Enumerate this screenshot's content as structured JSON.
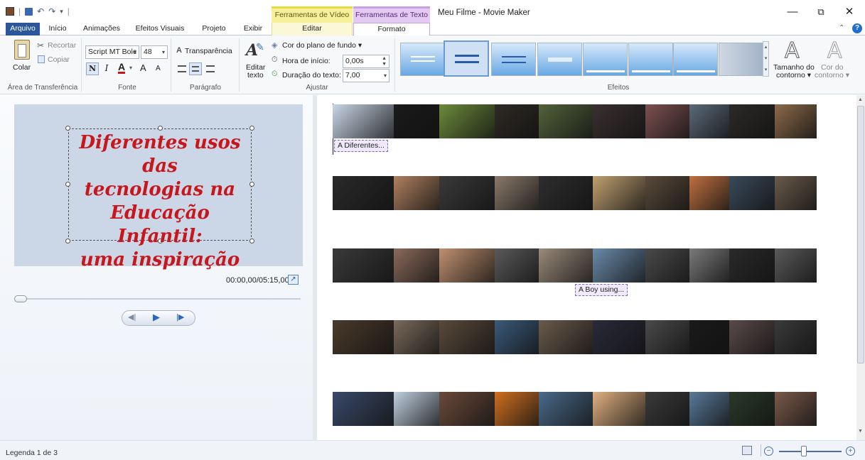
{
  "app": {
    "window_title": "Meu Filme - Movie Maker",
    "context_headers": {
      "video": "Ferramentas de Vídeo",
      "text": "Ferramentas de Texto"
    },
    "window_controls": {
      "minimize": "—",
      "restore": "⧉",
      "close": "✕"
    }
  },
  "tabs": [
    {
      "label": "Arquivo"
    },
    {
      "label": "Início"
    },
    {
      "label": "Animações"
    },
    {
      "label": "Efeitos Visuais"
    },
    {
      "label": "Projeto"
    },
    {
      "label": "Exibir"
    },
    {
      "label": "Editar"
    },
    {
      "label": "Formato"
    }
  ],
  "ribbon": {
    "clipboard": {
      "paste": "Colar",
      "cut": "Recortar",
      "copy": "Copiar",
      "group": "Área de Transferência"
    },
    "font": {
      "family": "Script MT Bolc",
      "size": "48",
      "bold": "N",
      "italic": "I",
      "color": "A",
      "grow": "A",
      "shrink": "A",
      "group": "Fonte"
    },
    "paragraph": {
      "transparency": "Transparência",
      "group": "Parágrafo"
    },
    "adjust": {
      "edit_text_1": "Editar",
      "edit_text_2": "texto",
      "bg_color": "Cor do plano de fundo",
      "start_time_label": "Hora de início:",
      "start_time": "0,00s",
      "duration_label": "Duração do texto:",
      "duration": "7,00",
      "group": "Ajustar"
    },
    "effects": {
      "group": "Efeitos"
    },
    "outline": {
      "size_1": "Tamanho do",
      "size_2": "contorno",
      "color_1": "Cor do",
      "color_2": "contorno"
    }
  },
  "preview": {
    "text_lines": [
      "Diferentes usos das",
      "tecnologias na",
      "Educação Infantil:",
      "uma inspiração"
    ],
    "time": "00:00,00/05:15,00"
  },
  "storyboard": {
    "captions": [
      "A Diferentes...",
      "A Boy using..."
    ]
  },
  "status": {
    "caption_count": "Legenda 1 de 3"
  },
  "colors": {
    "accent": "#2b579a",
    "video_tools": "#f6f09a",
    "text_tools": "#e4c9f2",
    "preview_text": "#c8161d"
  }
}
